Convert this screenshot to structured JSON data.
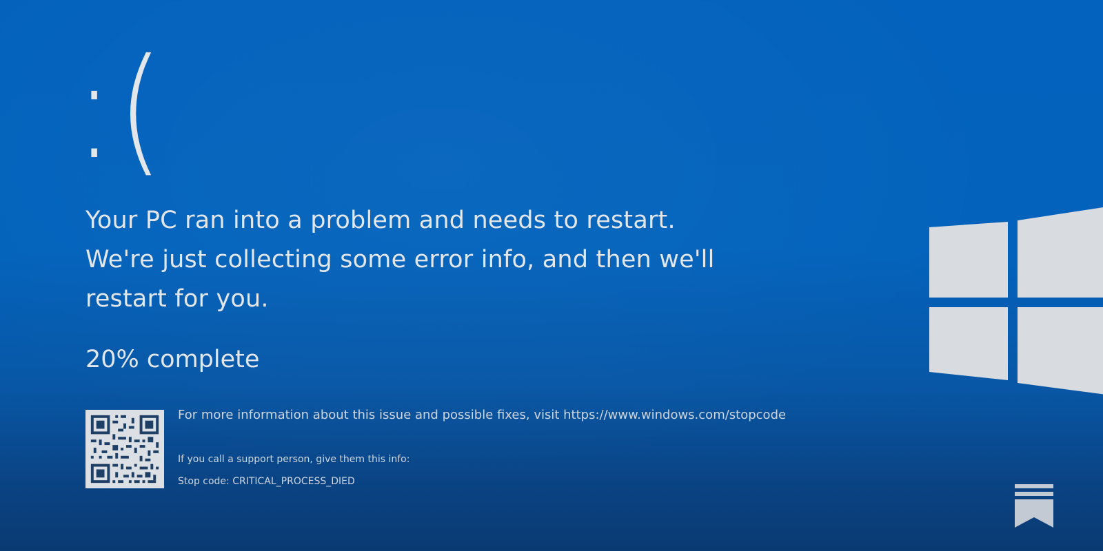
{
  "screen": {
    "frown": ":(",
    "message": "Your PC ran into a problem and needs to restart. We're just collecting some error info, and then we'll restart for you.",
    "progress_text": "20% complete",
    "progress_percent": 20,
    "more_info": "For more information about this issue and possible fixes, visit https://www.windows.com/stopcode",
    "support_prompt": "If you call a support person, give them this info:",
    "stop_code": "Stop code: CRITICAL_PROCESS_DIED"
  },
  "icons": {
    "qr": "qr-code-icon",
    "logo": "windows-logo-icon",
    "overlay": "bookmark-icon"
  },
  "colors": {
    "background": "#0362bd",
    "foreground": "#e3e6ea"
  }
}
